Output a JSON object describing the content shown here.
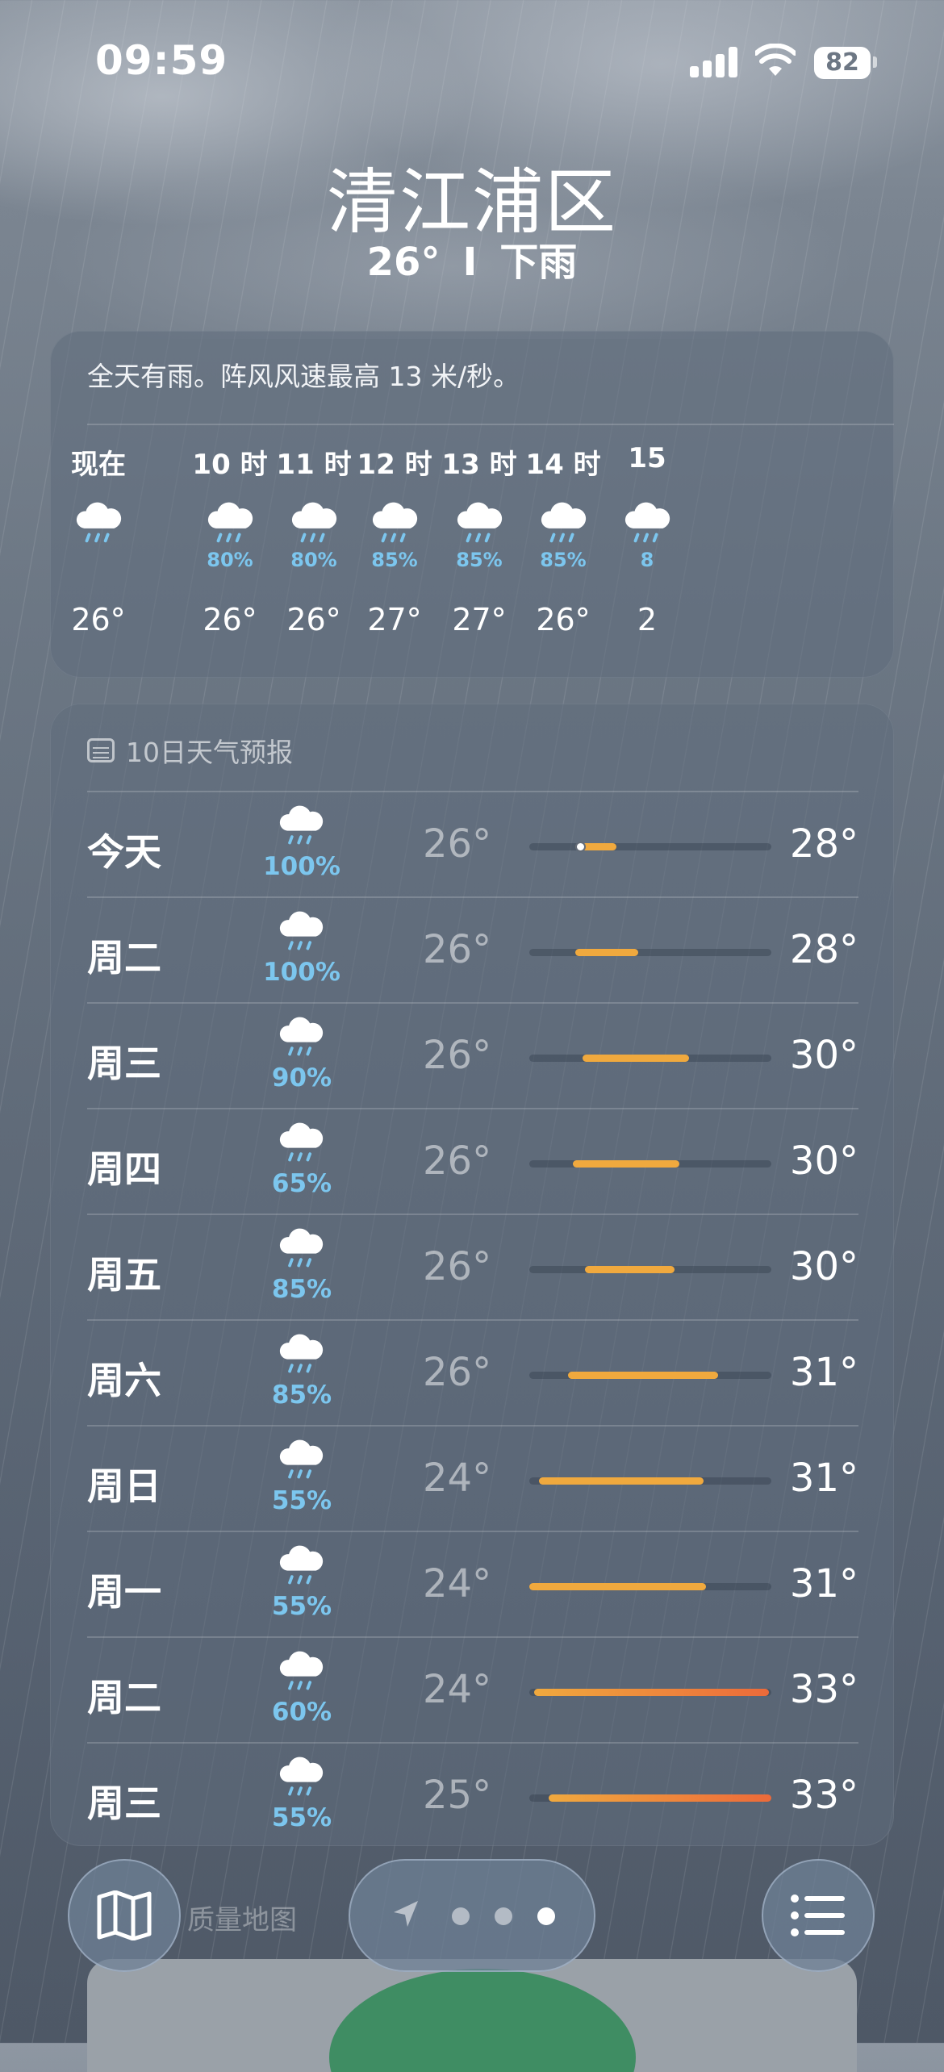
{
  "status_bar": {
    "time": "09:59",
    "battery": "82"
  },
  "header": {
    "city": "清江浦区",
    "temperature": "26°",
    "separator": "I",
    "condition": "下雨"
  },
  "hourly": {
    "summary": "全天有雨。阵风风速最高 13 米/秒。",
    "items": [
      {
        "label": "现在",
        "precip": "",
        "temp": "26°"
      },
      {
        "label": "10 时",
        "precip": "80%",
        "temp": "26°"
      },
      {
        "label": "11 时",
        "precip": "80%",
        "temp": "26°"
      },
      {
        "label": "12 时",
        "precip": "85%",
        "temp": "27°"
      },
      {
        "label": "13 时",
        "precip": "85%",
        "temp": "27°"
      },
      {
        "label": "14 时",
        "precip": "85%",
        "temp": "26°"
      },
      {
        "label": "15",
        "precip": "8",
        "temp": "2"
      }
    ]
  },
  "daily": {
    "title": "10日天气预报",
    "days": [
      {
        "name": "今天",
        "precip": "100%",
        "low": "26°",
        "high": "28°"
      },
      {
        "name": "周二",
        "precip": "100%",
        "low": "26°",
        "high": "28°"
      },
      {
        "name": "周三",
        "precip": "90%",
        "low": "26°",
        "high": "30°"
      },
      {
        "name": "周四",
        "precip": "65%",
        "low": "26°",
        "high": "30°"
      },
      {
        "name": "周五",
        "precip": "85%",
        "low": "26°",
        "high": "30°"
      },
      {
        "name": "周六",
        "precip": "85%",
        "low": "26°",
        "high": "31°"
      },
      {
        "name": "周日",
        "precip": "55%",
        "low": "24°",
        "high": "31°"
      },
      {
        "name": "周一",
        "precip": "55%",
        "low": "24°",
        "high": "31°"
      },
      {
        "name": "周二",
        "precip": "60%",
        "low": "24°",
        "high": "33°"
      },
      {
        "name": "周三",
        "precip": "55%",
        "low": "25°",
        "high": "33°"
      }
    ],
    "range_bars": [
      {
        "start": 0.19,
        "end": 0.36,
        "current": 0.21
      },
      {
        "start": 0.19,
        "end": 0.45
      },
      {
        "start": 0.22,
        "end": 0.66
      },
      {
        "start": 0.18,
        "end": 0.62
      },
      {
        "start": 0.23,
        "end": 0.6
      },
      {
        "start": 0.16,
        "end": 0.78
      },
      {
        "start": 0.04,
        "end": 0.72
      },
      {
        "start": 0.0,
        "end": 0.73
      },
      {
        "start": 0.02,
        "end": 0.99
      },
      {
        "start": 0.08,
        "end": 1.0
      }
    ]
  },
  "bottom": {
    "map_label": "质量地图",
    "pages": 3,
    "active_page": 3
  },
  "colors": {
    "precip": "#7cc6ee",
    "bar_warm": "#f0a93e",
    "bar_hot": "#ec6a3a",
    "card": "#5f6c7c"
  },
  "icons": {
    "map": "map-icon",
    "location": "location-arrow-icon",
    "list": "list-icon",
    "rain": "rain-cloud-icon",
    "calendar": "calendar-icon"
  }
}
